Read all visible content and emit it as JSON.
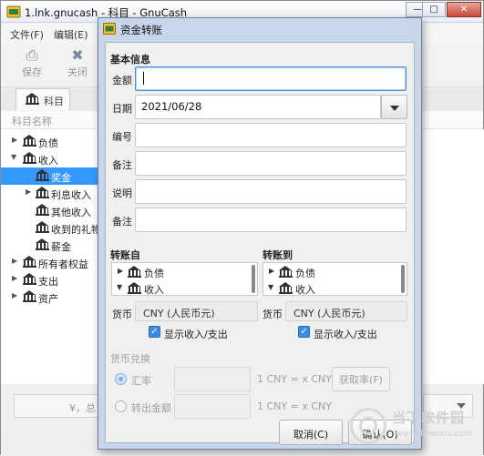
{
  "main_window": {
    "title": "1.lnk.gnucash - 科目 - GnuCash",
    "window_buttons": [
      "—",
      "□",
      "✕"
    ],
    "menu": [
      "文件(F)",
      "编辑(E)"
    ],
    "toolbar": [
      {
        "label": "保存",
        "icon": "save-icon"
      },
      {
        "label": "关闭",
        "icon": "close-icon"
      }
    ],
    "tab_label": "科目",
    "tree_header": "科目名称",
    "tree": [
      {
        "label": "负债",
        "expander": "collapsed",
        "level": 0
      },
      {
        "label": "收入",
        "expander": "expanded",
        "level": 0
      },
      {
        "label": "奖金",
        "expander": "none",
        "level": 1,
        "selected": true
      },
      {
        "label": "利息收入",
        "expander": "collapsed",
        "level": 1
      },
      {
        "label": "其他收入",
        "expander": "none",
        "level": 1
      },
      {
        "label": "收到的礼物",
        "expander": "none",
        "level": 1
      },
      {
        "label": "薪金",
        "expander": "none",
        "level": 1
      },
      {
        "label": "所有者权益",
        "expander": "collapsed",
        "level": 0
      },
      {
        "label": "支出",
        "expander": "collapsed",
        "level": 0
      },
      {
        "label": "资产",
        "expander": "collapsed",
        "level": 0
      }
    ],
    "bottom_bar_text": "¥，总"
  },
  "dialog": {
    "title": "资金转账",
    "basic_section": "基本信息",
    "fields": {
      "amount_label": "金额",
      "amount_value": "",
      "date_label": "日期",
      "date_value": "2021/06/28",
      "number_label": "编号",
      "description_label": "备注",
      "explain_label": "说明",
      "memo_label": "备注"
    },
    "transfer_from": {
      "title": "转账自",
      "accounts": [
        {
          "label": "负债",
          "expander": "collapsed"
        },
        {
          "label": "收入",
          "expander": "expanded"
        }
      ],
      "currency_label": "货币",
      "currency_value": "CNY (人民币元)",
      "show_income_expense": "显示收入/支出",
      "checked": true
    },
    "transfer_to": {
      "title": "转账到",
      "accounts": [
        {
          "label": "负债",
          "expander": "collapsed"
        },
        {
          "label": "收入",
          "expander": "expanded"
        }
      ],
      "currency_label": "货币",
      "currency_value": "CNY (人民币元)",
      "show_income_expense": "显示收入/支出",
      "checked": true
    },
    "exchange": {
      "section": "货币兑换",
      "rate_label": "汇率",
      "rate_formula": "1 CNY = x CNY",
      "fetch_button": "获取率(F)",
      "amount_label": "转出金额",
      "amount_formula": "1 CNY = x CNY"
    },
    "buttons": {
      "cancel": "取消(C)",
      "ok": "确认(O)"
    }
  },
  "watermark": {
    "line1": "当下软件园",
    "line2": "www.downxia.com"
  },
  "colors": {
    "selection": "#3399ff",
    "dialog_frame": "#c7d6eb",
    "focus_border": "#4a90d9",
    "checkbox": "#3d8be0"
  }
}
